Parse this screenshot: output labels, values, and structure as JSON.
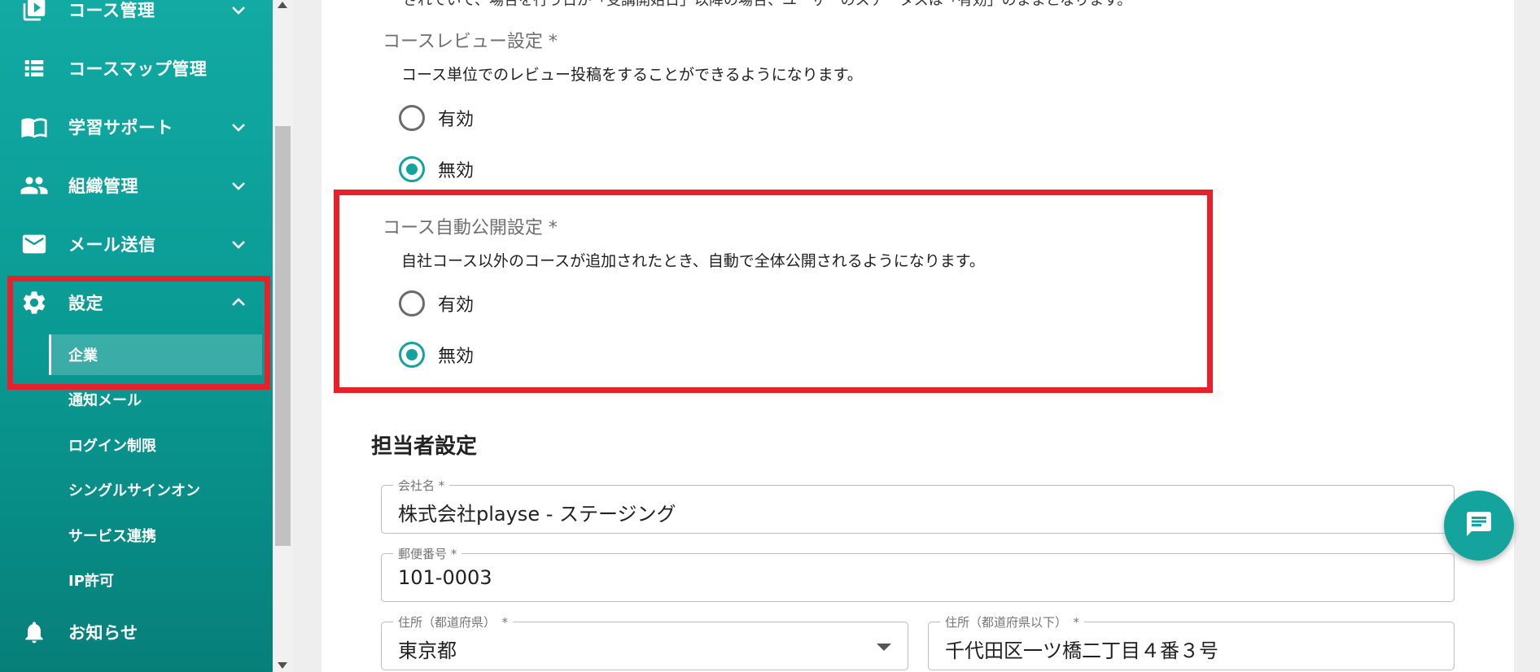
{
  "sidebar": {
    "items": [
      {
        "label": "コース管理",
        "icon": "video-library-icon"
      },
      {
        "label": "コースマップ管理",
        "icon": "list-icon"
      },
      {
        "label": "学習サポート",
        "icon": "book-icon"
      },
      {
        "label": "組織管理",
        "icon": "people-icon"
      },
      {
        "label": "メール送信",
        "icon": "mail-icon"
      },
      {
        "label": "設定",
        "icon": "gear-icon"
      },
      {
        "label": "お知らせ",
        "icon": "bell-icon"
      }
    ],
    "settings_subitems": [
      "企業",
      "通知メール",
      "ログイン制限",
      "シングルサインオン",
      "サービス連携",
      "IP許可"
    ],
    "active_subitem": "企業"
  },
  "content": {
    "clipped_text": "されていて、場合を行う日が「受講開始日」以降の場合、ユーザーのステータスは「有効」のままとなります。",
    "course_review": {
      "label": "コースレビュー設定 *",
      "description": "コース単位でのレビュー投稿をすることができるようになります。",
      "options": [
        "有効",
        "無効"
      ],
      "selected": "無効"
    },
    "course_auto_publish": {
      "label": "コース自動公開設定 *",
      "description": "自社コース以外のコースが追加されたとき、自動で全体公開されるようになります。",
      "options": [
        "有効",
        "無効"
      ],
      "selected": "無効"
    },
    "contact_settings": {
      "title": "担当者設定",
      "company_name": {
        "label": "会社名 *",
        "value": "株式会社playse - ステージング"
      },
      "postal_code": {
        "label": "郵便番号 *",
        "value": "101-0003"
      },
      "prefecture": {
        "label": "住所（都道府県）　*",
        "value": "東京都"
      },
      "address": {
        "label": "住所（都道府県以下）　*",
        "value": "千代田区一ツ橋二丁目４番３号"
      }
    }
  },
  "colors": {
    "accent": "#14a49d",
    "highlight": "#e8202a"
  },
  "fab": {
    "icon": "chat-icon"
  }
}
